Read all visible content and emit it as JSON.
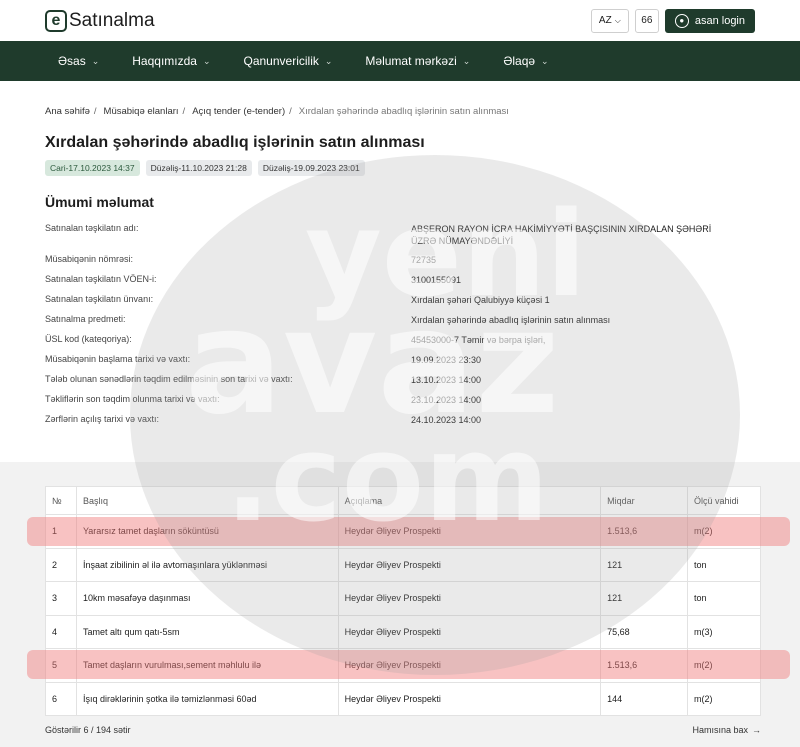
{
  "header": {
    "logo_letter": "e",
    "logo_text": "Satınalma",
    "language": "AZ",
    "accessibility": "66",
    "login_label": "asan login"
  },
  "nav": {
    "items": [
      {
        "label": "Əsas"
      },
      {
        "label": "Haqqımızda"
      },
      {
        "label": "Qanunvericilik"
      },
      {
        "label": "Məlumat mərkəzi"
      },
      {
        "label": "Əlaqə"
      }
    ]
  },
  "breadcrumb": {
    "items": [
      "Ana səhifə",
      "Müsabiqə elanları",
      "Açıq tender (e-tender)"
    ],
    "current": "Xırdalan şəhərində abadlıq işlərinin satın alınması"
  },
  "page": {
    "title": "Xırdalan şəhərində abadlıq işlərinin satın alınması",
    "badges": [
      "Cari-17.10.2023 14:37",
      "Düzəliş-11.10.2023 21:28",
      "Düzəliş-19.09.2023 23:01"
    ]
  },
  "general": {
    "title": "Ümumi məlumat",
    "rows": [
      {
        "label": "Satınalan təşkilatın adı:",
        "value": "ABŞERON RAYON İCRA HAKİMİYYƏTİ BAŞÇISININ XIRDALAN ŞƏHƏRİ ÜZRƏ NÜMAYƏNDƏLİYİ"
      },
      {
        "label": "Müsabiqənin nömrəsi:",
        "value": "72735"
      },
      {
        "label": "Satınalan təşkilatın VÖEN-i:",
        "value": "3100155091"
      },
      {
        "label": "Satınalan təşkilatın ünvanı:",
        "value": "Xırdalan şəhəri Qalubiyyə küçəsi 1"
      },
      {
        "label": "Satınalma predmeti:",
        "value": "Xırdalan şəhərində abadlıq işlərinin satın alınması"
      },
      {
        "label": "ÜSL kod (kateqoriya):",
        "value": "45453000-7 Təmir və bərpa işləri,"
      },
      {
        "label": "Müsabiqənin başlama tarixi və vaxtı:",
        "value": "19.09.2023 23:30"
      },
      {
        "label": "Tələb olunan sənədlərin təqdim edilməsinin son tarixi və vaxtı:",
        "value": "13.10.2023 14:00"
      },
      {
        "label": "Təkliflərin son təqdim olunma tarixi və vaxtı:",
        "value": "23.10.2023 14:00"
      },
      {
        "label": "Zərflərin açılış tarixi və vaxtı:",
        "value": "24.10.2023 14:00"
      }
    ]
  },
  "table": {
    "headers": [
      "№",
      "Başlıq",
      "Açıqlama",
      "Miqdar",
      "Ölçü vahidi"
    ],
    "rows": [
      [
        "1",
        "Yararsız tamet daşların söküntüsü",
        "Heydər Əliyev Prospekti",
        "1.513,6",
        "m(2)"
      ],
      [
        "2",
        "İnşaat zibilinin əl ilə avtomaşınlara yüklənməsi",
        "Heydər Əliyev Prospekti",
        "121",
        "ton"
      ],
      [
        "3",
        "10km məsafəyə daşınması",
        "Heydər Əliyev Prospekti",
        "121",
        "ton"
      ],
      [
        "4",
        "Tamet altı qum qatı-5sm",
        "Heydər Əliyev Prospekti",
        "75,68",
        "m(3)"
      ],
      [
        "5",
        "Tamet daşların vurulması,sement məhlulu ilə",
        "Heydər Əliyev Prospekti",
        "1.513,6",
        "m(2)"
      ],
      [
        "6",
        "İşıq dirəklərinin şotka ilə təmizlənməsi 60əd",
        "Heydər Əliyev Prospekti",
        "144",
        "m(2)"
      ]
    ],
    "shown_label": "Göstərilir 6 / 194 sətir",
    "see_all_label": "Hamısına bax",
    "see_all_arrow": "→"
  },
  "watermark": {
    "line1": "yeni",
    "line2": "avaz",
    "line3": ".com"
  }
}
